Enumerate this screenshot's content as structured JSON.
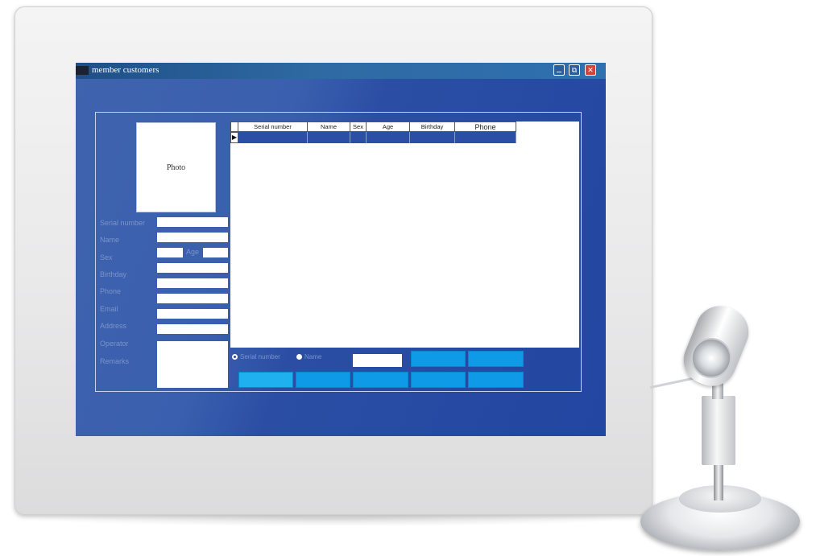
{
  "window": {
    "title": "member customers",
    "minimize_label": "",
    "maximize_label": "⧉",
    "close_label": "✕"
  },
  "photo": {
    "label": "Photo"
  },
  "form": {
    "labels": [
      "Serial number",
      "Name",
      "Sex",
      "Birthday",
      "Phone",
      "Email",
      "Address",
      "Operator",
      "Remarks"
    ],
    "age_label": "Age"
  },
  "grid": {
    "columns": [
      "Serial number",
      "Name",
      "Sex",
      "Age",
      "Birthday",
      "Phone"
    ],
    "row_indicator": "▶"
  },
  "search": {
    "options": [
      "Serial number",
      "Name"
    ],
    "selected": "Serial number",
    "value": ""
  },
  "colors": {
    "screen": "#2a4fa5",
    "button": "#0e9ae6",
    "close": "#d9423a"
  }
}
